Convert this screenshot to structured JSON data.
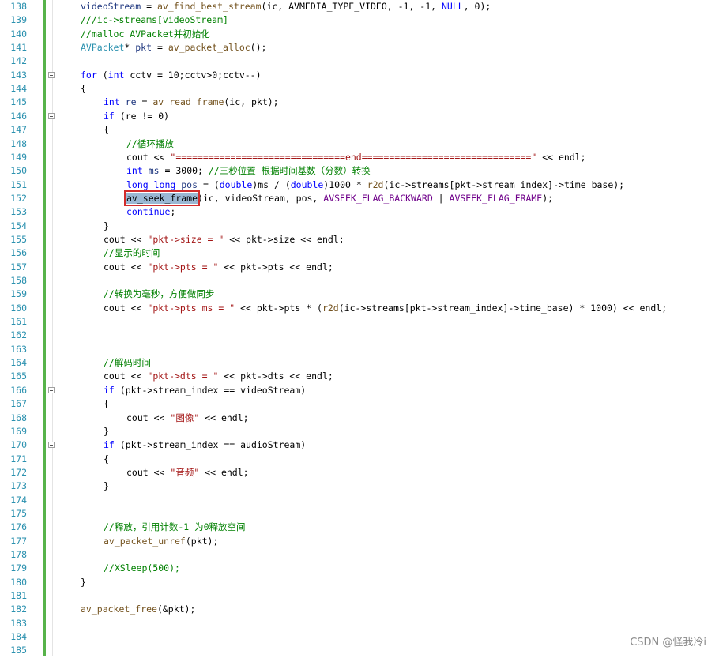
{
  "editor": {
    "lines": [
      {
        "n": "138",
        "indent": 0,
        "fold": false,
        "tokens": [
          [
            "v",
            "videoStream"
          ],
          [
            "p",
            " = "
          ],
          [
            "f",
            "av_find_best_stream"
          ],
          [
            "p",
            "(ic, AVMEDIA_TYPE_VIDEO, -1, -1, "
          ],
          [
            "k",
            "NULL"
          ],
          [
            "p",
            ", 0);"
          ]
        ]
      },
      {
        "n": "139",
        "indent": 0,
        "fold": false,
        "tokens": [
          [
            "c",
            "///ic->streams[videoStream]"
          ]
        ]
      },
      {
        "n": "140",
        "indent": 0,
        "fold": false,
        "tokens": [
          [
            "c",
            "//malloc AVPacket并初始化"
          ]
        ]
      },
      {
        "n": "141",
        "indent": 0,
        "fold": false,
        "tokens": [
          [
            "ty",
            "AVPacket"
          ],
          [
            "p",
            "* "
          ],
          [
            "v",
            "pkt"
          ],
          [
            "p",
            " = "
          ],
          [
            "f",
            "av_packet_alloc"
          ],
          [
            "p",
            "();"
          ]
        ]
      },
      {
        "n": "142",
        "indent": 0,
        "fold": false,
        "tokens": []
      },
      {
        "n": "143",
        "indent": 0,
        "fold": true,
        "tokens": [
          [
            "k",
            "for"
          ],
          [
            "p",
            " ("
          ],
          [
            "k",
            "int"
          ],
          [
            "p",
            " cctv = 10;cctv>0;cctv--)"
          ]
        ]
      },
      {
        "n": "144",
        "indent": 0,
        "fold": false,
        "tokens": [
          [
            "p",
            "{"
          ]
        ]
      },
      {
        "n": "145",
        "indent": 1,
        "fold": false,
        "tokens": [
          [
            "k",
            "int"
          ],
          [
            "p",
            " "
          ],
          [
            "v",
            "re"
          ],
          [
            "p",
            " = "
          ],
          [
            "f",
            "av_read_frame"
          ],
          [
            "p",
            "(ic, pkt);"
          ]
        ]
      },
      {
        "n": "146",
        "indent": 1,
        "fold": true,
        "tokens": [
          [
            "k",
            "if"
          ],
          [
            "p",
            " (re != 0)"
          ]
        ]
      },
      {
        "n": "147",
        "indent": 1,
        "fold": false,
        "tokens": [
          [
            "p",
            "{"
          ]
        ]
      },
      {
        "n": "148",
        "indent": 2,
        "fold": false,
        "tokens": [
          [
            "c",
            "//循环播放"
          ]
        ]
      },
      {
        "n": "149",
        "indent": 2,
        "fold": false,
        "tokens": [
          [
            "p",
            "cout << "
          ],
          [
            "s",
            "\"===============================end===============================\""
          ],
          [
            "p",
            " << endl;"
          ]
        ]
      },
      {
        "n": "150",
        "indent": 2,
        "fold": false,
        "tokens": [
          [
            "k",
            "int"
          ],
          [
            "p",
            " "
          ],
          [
            "v",
            "ms"
          ],
          [
            "p",
            " = 3000; "
          ],
          [
            "c",
            "//三秒位置 根据时间基数（分数）转换"
          ]
        ]
      },
      {
        "n": "151",
        "indent": 2,
        "fold": false,
        "tokens": [
          [
            "k",
            "long long"
          ],
          [
            "p",
            " "
          ],
          [
            "v",
            "pos"
          ],
          [
            "p",
            " = ("
          ],
          [
            "k",
            "double"
          ],
          [
            "p",
            ")ms / ("
          ],
          [
            "k",
            "double"
          ],
          [
            "p",
            ")1000 * "
          ],
          [
            "f",
            "r2d"
          ],
          [
            "p",
            "(ic->streams[pkt->stream_index]->time_base);"
          ]
        ]
      },
      {
        "n": "152",
        "indent": 2,
        "fold": false,
        "tokens": [
          [
            "hl",
            "av_seek_frame"
          ],
          [
            "p",
            "(ic, videoStream, pos, "
          ],
          [
            "m",
            "AVSEEK_FLAG_BACKWARD"
          ],
          [
            "p",
            " | "
          ],
          [
            "m",
            "AVSEEK_FLAG_FRAME"
          ],
          [
            "p",
            ");"
          ]
        ]
      },
      {
        "n": "153",
        "indent": 2,
        "fold": false,
        "tokens": [
          [
            "k",
            "continue"
          ],
          [
            "p",
            ";"
          ]
        ]
      },
      {
        "n": "154",
        "indent": 1,
        "fold": false,
        "tokens": [
          [
            "p",
            "}"
          ]
        ]
      },
      {
        "n": "155",
        "indent": 1,
        "fold": false,
        "tokens": [
          [
            "p",
            "cout << "
          ],
          [
            "s",
            "\"pkt->size = \""
          ],
          [
            "p",
            " << pkt->size << endl;"
          ]
        ]
      },
      {
        "n": "156",
        "indent": 1,
        "fold": false,
        "tokens": [
          [
            "c",
            "//显示的时间"
          ]
        ]
      },
      {
        "n": "157",
        "indent": 1,
        "fold": false,
        "tokens": [
          [
            "p",
            "cout << "
          ],
          [
            "s",
            "\"pkt->pts = \""
          ],
          [
            "p",
            " << pkt->pts << endl;"
          ]
        ]
      },
      {
        "n": "158",
        "indent": 0,
        "fold": false,
        "tokens": []
      },
      {
        "n": "159",
        "indent": 1,
        "fold": false,
        "tokens": [
          [
            "c",
            "//转换为毫秒，方便做同步"
          ]
        ]
      },
      {
        "n": "160",
        "indent": 1,
        "fold": false,
        "tokens": [
          [
            "p",
            "cout << "
          ],
          [
            "s",
            "\"pkt->pts ms = \""
          ],
          [
            "p",
            " << pkt->pts * ("
          ],
          [
            "f",
            "r2d"
          ],
          [
            "p",
            "(ic->streams[pkt->stream_index]->time_base) * 1000) << endl;"
          ]
        ]
      },
      {
        "n": "161",
        "indent": 0,
        "fold": false,
        "tokens": []
      },
      {
        "n": "162",
        "indent": 0,
        "fold": false,
        "tokens": []
      },
      {
        "n": "163",
        "indent": 0,
        "fold": false,
        "tokens": []
      },
      {
        "n": "164",
        "indent": 1,
        "fold": false,
        "tokens": [
          [
            "c",
            "//解码时间"
          ]
        ]
      },
      {
        "n": "165",
        "indent": 1,
        "fold": false,
        "tokens": [
          [
            "p",
            "cout << "
          ],
          [
            "s",
            "\"pkt->dts = \""
          ],
          [
            "p",
            " << pkt->dts << endl;"
          ]
        ]
      },
      {
        "n": "166",
        "indent": 1,
        "fold": true,
        "tokens": [
          [
            "k",
            "if"
          ],
          [
            "p",
            " (pkt->stream_index == videoStream)"
          ]
        ]
      },
      {
        "n": "167",
        "indent": 1,
        "fold": false,
        "tokens": [
          [
            "p",
            "{"
          ]
        ]
      },
      {
        "n": "168",
        "indent": 2,
        "fold": false,
        "tokens": [
          [
            "p",
            "cout << "
          ],
          [
            "s",
            "\"图像\""
          ],
          [
            "p",
            " << endl;"
          ]
        ]
      },
      {
        "n": "169",
        "indent": 1,
        "fold": false,
        "tokens": [
          [
            "p",
            "}"
          ]
        ]
      },
      {
        "n": "170",
        "indent": 1,
        "fold": true,
        "tokens": [
          [
            "k",
            "if"
          ],
          [
            "p",
            " (pkt->stream_index == audioStream)"
          ]
        ]
      },
      {
        "n": "171",
        "indent": 1,
        "fold": false,
        "tokens": [
          [
            "p",
            "{"
          ]
        ]
      },
      {
        "n": "172",
        "indent": 2,
        "fold": false,
        "tokens": [
          [
            "p",
            "cout << "
          ],
          [
            "s",
            "\"音频\""
          ],
          [
            "p",
            " << endl;"
          ]
        ]
      },
      {
        "n": "173",
        "indent": 1,
        "fold": false,
        "tokens": [
          [
            "p",
            "}"
          ]
        ]
      },
      {
        "n": "174",
        "indent": 0,
        "fold": false,
        "tokens": []
      },
      {
        "n": "175",
        "indent": 0,
        "fold": false,
        "tokens": []
      },
      {
        "n": "176",
        "indent": 1,
        "fold": false,
        "tokens": [
          [
            "c",
            "//释放，引用计数-1 为0释放空间"
          ]
        ]
      },
      {
        "n": "177",
        "indent": 1,
        "fold": false,
        "tokens": [
          [
            "f",
            "av_packet_unref"
          ],
          [
            "p",
            "(pkt);"
          ]
        ]
      },
      {
        "n": "178",
        "indent": 0,
        "fold": false,
        "tokens": []
      },
      {
        "n": "179",
        "indent": 1,
        "fold": false,
        "tokens": [
          [
            "c",
            "//XSleep(500);"
          ]
        ]
      },
      {
        "n": "180",
        "indent": 0,
        "fold": false,
        "tokens": [
          [
            "p",
            "}"
          ]
        ]
      },
      {
        "n": "181",
        "indent": 0,
        "fold": false,
        "tokens": []
      },
      {
        "n": "182",
        "indent": 0,
        "fold": false,
        "tokens": [
          [
            "f",
            "av_packet_free"
          ],
          [
            "p",
            "(&pkt);"
          ]
        ]
      },
      {
        "n": "183",
        "indent": 0,
        "fold": false,
        "tokens": []
      },
      {
        "n": "184",
        "indent": 0,
        "fold": false,
        "tokens": []
      },
      {
        "n": "185",
        "indent": 0,
        "fold": false,
        "tokens": []
      }
    ]
  },
  "watermark": "CSDN @怪我冷i",
  "colors": {
    "keyword": "#0000ff",
    "string": "#a31515",
    "comment": "#008000",
    "macro": "#6f008a",
    "type": "#2b91af",
    "line_number": "#2b91af",
    "change_bar": "#57b34a",
    "highlight": "#9bb8d4",
    "highlight_border": "#d22c2c"
  }
}
